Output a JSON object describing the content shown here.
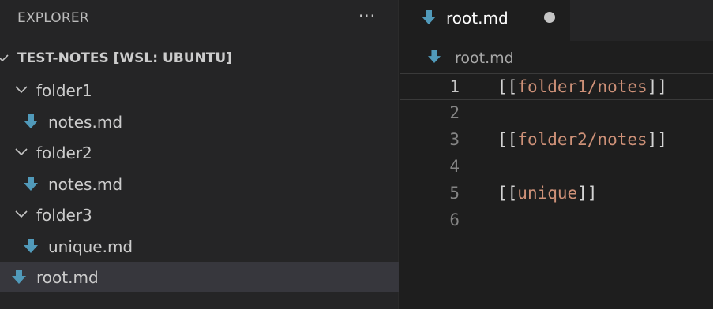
{
  "explorer": {
    "title": "EXPLORER",
    "more_label": "···",
    "workspace": "TEST-NOTES [WSL: UBUNTU]",
    "items": [
      {
        "label": "folder1",
        "type": "folder"
      },
      {
        "label": "notes.md",
        "type": "file"
      },
      {
        "label": "folder2",
        "type": "folder"
      },
      {
        "label": "notes.md",
        "type": "file"
      },
      {
        "label": "folder3",
        "type": "folder"
      },
      {
        "label": "unique.md",
        "type": "file"
      },
      {
        "label": "root.md",
        "type": "file",
        "selected": true
      }
    ]
  },
  "editor": {
    "tab": {
      "label": "root.md",
      "dirty": true
    },
    "breadcrumb": "root.md",
    "lines": [
      {
        "number": "1",
        "open": "[[",
        "link": "folder1/notes",
        "close": "]]"
      },
      {
        "number": "2",
        "open": "",
        "link": "",
        "close": ""
      },
      {
        "number": "3",
        "open": "[[",
        "link": "folder2/notes",
        "close": "]]"
      },
      {
        "number": "4",
        "open": "",
        "link": "",
        "close": ""
      },
      {
        "number": "5",
        "open": "[[",
        "link": "unique",
        "close": "]]"
      },
      {
        "number": "6",
        "open": "",
        "link": "",
        "close": ""
      }
    ]
  },
  "colors": {
    "markdown_icon": "#519aba",
    "link_text": "#ce9178",
    "selection": "#37373d"
  },
  "icons": {
    "markdown": "markdown-down-arrow-icon",
    "chevron": "chevron-down-icon",
    "dirty": "unsaved-dot-icon"
  }
}
